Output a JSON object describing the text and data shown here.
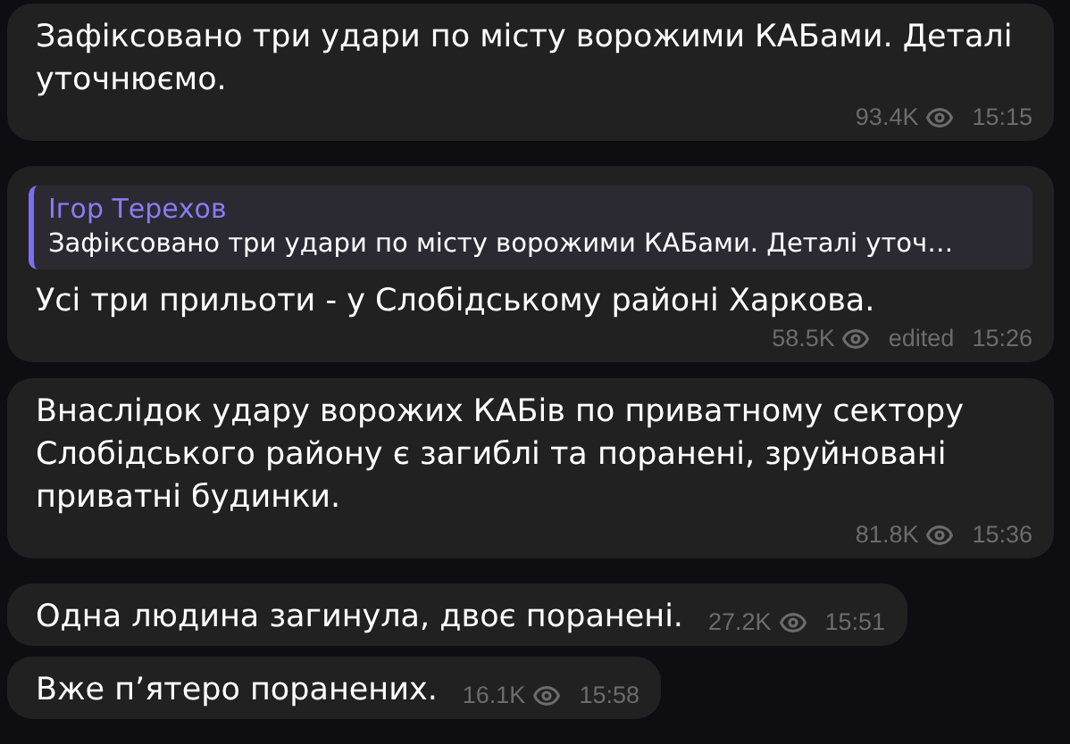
{
  "messages": [
    {
      "text": "Зафіксовано три удари по місту ворожими КАБами. Деталі уточнюємо.",
      "views": "93.4K",
      "time": "15:15"
    },
    {
      "reply": {
        "author": "Ігор Терехов",
        "text": "Зафіксовано три удари по місту ворожими КАБами. Деталі уточ…"
      },
      "text": "Усі три прильоти - у Слобідському районі Харкова.",
      "views": "58.5K",
      "edited_label": "edited",
      "time": "15:26"
    },
    {
      "text": "Внаслідок удару ворожих КАБів по приватному сектору Слобідського району є загиблі та поранені, зруйновані приватні будинки.",
      "views": "81.8K",
      "time": "15:36"
    },
    {
      "text": "Одна людина загинула, двоє поранені.",
      "views": "27.2K",
      "time": "15:51"
    },
    {
      "text": "Вже п’ятеро поранених.",
      "views": "16.1K",
      "time": "15:58"
    }
  ]
}
